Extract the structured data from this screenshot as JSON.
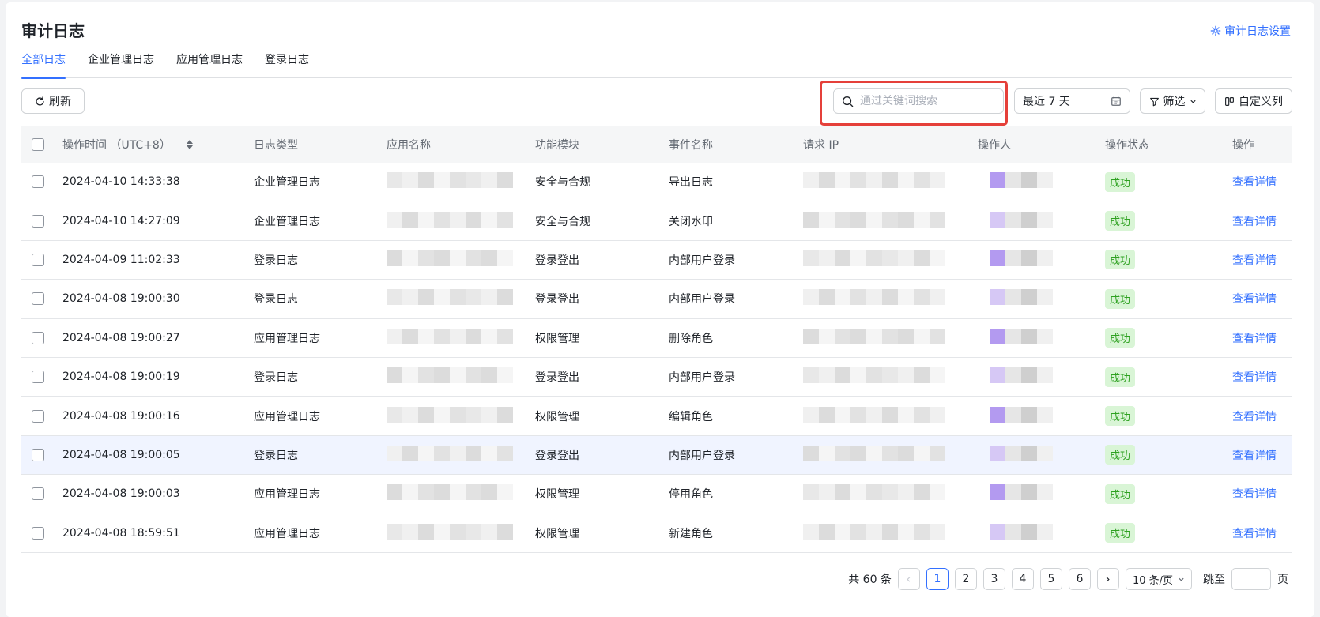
{
  "header": {
    "title": "审计日志",
    "settings_label": "审计日志设置"
  },
  "tabs": [
    {
      "label": "全部日志",
      "active": true
    },
    {
      "label": "企业管理日志",
      "active": false
    },
    {
      "label": "应用管理日志",
      "active": false
    },
    {
      "label": "登录日志",
      "active": false
    }
  ],
  "toolbar": {
    "refresh_label": "刷新",
    "search_placeholder": "通过关键词搜索",
    "date_range_label": "最近 7 天",
    "filter_label": "筛选",
    "custom_columns_label": "自定义列"
  },
  "table": {
    "columns": [
      "操作时间 （UTC+8）",
      "日志类型",
      "应用名称",
      "功能模块",
      "事件名称",
      "请求 IP",
      "操作人",
      "操作状态",
      "操作"
    ],
    "rows": [
      {
        "time": "2024-04-10 14:33:38",
        "type": "企业管理日志",
        "module": "安全与合规",
        "event": "导出日志",
        "status": "成功",
        "action": "查看详情"
      },
      {
        "time": "2024-04-10 14:27:09",
        "type": "企业管理日志",
        "module": "安全与合规",
        "event": "关闭水印",
        "status": "成功",
        "action": "查看详情"
      },
      {
        "time": "2024-04-09 11:02:33",
        "type": "登录日志",
        "module": "登录登出",
        "event": "内部用户登录",
        "status": "成功",
        "action": "查看详情"
      },
      {
        "time": "2024-04-08 19:00:30",
        "type": "登录日志",
        "module": "登录登出",
        "event": "内部用户登录",
        "status": "成功",
        "action": "查看详情"
      },
      {
        "time": "2024-04-08 19:00:27",
        "type": "应用管理日志",
        "module": "权限管理",
        "event": "删除角色",
        "status": "成功",
        "action": "查看详情"
      },
      {
        "time": "2024-04-08 19:00:19",
        "type": "登录日志",
        "module": "登录登出",
        "event": "内部用户登录",
        "status": "成功",
        "action": "查看详情"
      },
      {
        "time": "2024-04-08 19:00:16",
        "type": "应用管理日志",
        "module": "权限管理",
        "event": "编辑角色",
        "status": "成功",
        "action": "查看详情"
      },
      {
        "time": "2024-04-08 19:00:05",
        "type": "登录日志",
        "module": "登录登出",
        "event": "内部用户登录",
        "status": "成功",
        "action": "查看详情"
      },
      {
        "time": "2024-04-08 19:00:03",
        "type": "应用管理日志",
        "module": "权限管理",
        "event": "停用角色",
        "status": "成功",
        "action": "查看详情"
      },
      {
        "time": "2024-04-08 18:59:51",
        "type": "应用管理日志",
        "module": "权限管理",
        "event": "新建角色",
        "status": "成功",
        "action": "查看详情"
      }
    ]
  },
  "pagination": {
    "total_label": "共 60 条",
    "pages": [
      "1",
      "2",
      "3",
      "4",
      "5",
      "6"
    ],
    "current_page": "1",
    "page_size_label": "10 条/页",
    "jump_label": "跳至",
    "page_suffix": "页"
  },
  "colors": {
    "accent": "#3370ff",
    "success_bg": "#d9f5d6",
    "success_text": "#2ea121",
    "highlight_border": "#e5403a"
  }
}
